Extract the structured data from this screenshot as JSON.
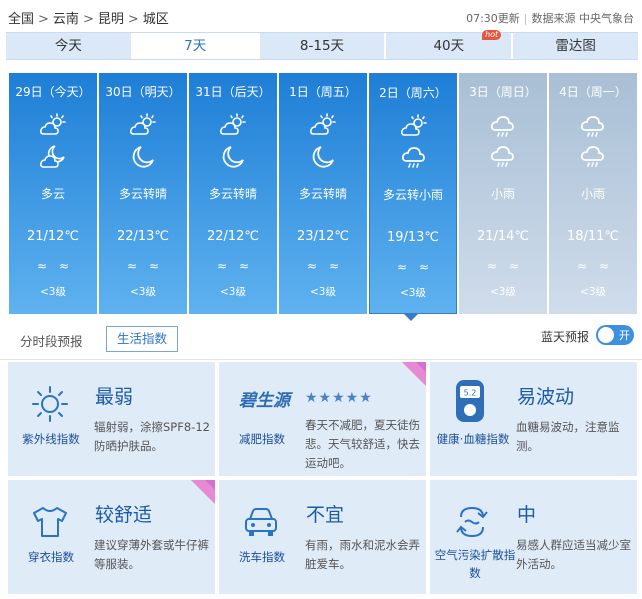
{
  "breadcrumb": [
    "全国",
    "云南",
    "昆明",
    "城区"
  ],
  "breadcrumb_sep": ">",
  "update_time": "07:30更新",
  "source": "数据来源 中央气象台",
  "tabs": [
    {
      "label": "今天",
      "active": false
    },
    {
      "label": "7天",
      "active": true
    },
    {
      "label": "8-15天",
      "active": false
    },
    {
      "label": "40天",
      "active": false,
      "badge": "hot"
    },
    {
      "label": "雷达图",
      "active": false
    }
  ],
  "days": [
    {
      "date": "29日（今天）",
      "icon1": "partly-cloudy-day-icon",
      "icon2": "partly-cloudy-night-icon",
      "desc": "多云",
      "temp": "21/12℃",
      "wave": "≈≈",
      "wind": "<3级",
      "style": "sun"
    },
    {
      "date": "30日（明天）",
      "icon1": "partly-cloudy-day-icon",
      "icon2": "moon-icon",
      "desc": "多云转晴",
      "temp": "22/13℃",
      "wave": "≈≈",
      "wind": "<3级",
      "style": "sun"
    },
    {
      "date": "31日（后天）",
      "icon1": "partly-cloudy-day-icon",
      "icon2": "moon-icon",
      "desc": "多云转晴",
      "temp": "22/12℃",
      "wave": "≈≈",
      "wind": "<3级",
      "style": "sun"
    },
    {
      "date": "1日（周五）",
      "icon1": "partly-cloudy-day-icon",
      "icon2": "moon-icon",
      "desc": "多云转晴",
      "temp": "23/12℃",
      "wave": "≈≈",
      "wind": "<3级",
      "style": "sun"
    },
    {
      "date": "2日（周六）",
      "icon1": "partly-cloudy-day-icon",
      "icon2": "light-rain-icon",
      "desc": "多云转小雨",
      "temp": "19/13℃",
      "wave": "≈≈",
      "wind": "<3级",
      "style": "sun",
      "selected": true
    },
    {
      "date": "3日（周日）",
      "icon1": "light-rain-icon",
      "icon2": "light-rain-icon",
      "desc": "小雨",
      "temp": "21/14℃",
      "wave": "≈≈",
      "wind": "<3级",
      "style": "rain"
    },
    {
      "date": "4日（周一）",
      "icon1": "light-rain-icon",
      "icon2": "light-rain-icon",
      "desc": "小雨",
      "temp": "18/11℃",
      "wave": "≈≈",
      "wind": "<3级",
      "style": "rain"
    }
  ],
  "subbar": {
    "hourly": "分时段预报",
    "life_index": "生活指数",
    "bluesky": "蓝天预报",
    "toggle_text": "开"
  },
  "cards": [
    {
      "caption": "紫外线指数",
      "level": "最弱",
      "text": "辐射弱，涂擦SPF8-12防晒护肤品。",
      "icon": "sun-icon"
    },
    {
      "caption": "减肥指数",
      "level": "",
      "text": "春天不减肥，夏天徒伤悲。天气较舒适，快去运动吧。",
      "icon": "logo-icon",
      "logo": "碧生源",
      "stars": "★★★★★",
      "corner": true
    },
    {
      "caption": "健康·血糖指数",
      "level": "易波动",
      "text": "血糖易波动，注意监测。",
      "icon": "glucose-meter-icon",
      "meter": "5.2"
    },
    {
      "caption": "穿衣指数",
      "level": "较舒适",
      "text": "建议穿薄外套或牛仔裤等服装。",
      "icon": "tshirt-icon",
      "corner": true
    },
    {
      "caption": "洗车指数",
      "level": "不宜",
      "text": "有雨，雨水和泥水会弄脏爱车。",
      "icon": "car-icon"
    },
    {
      "caption": "空气污染扩散指数",
      "level": "中",
      "text": "易感人群应适当减少室外活动。",
      "icon": "air-diffusion-icon"
    }
  ],
  "colors": {
    "sunny_top": "#1e7ed6",
    "rain_top": "#a9bfd5",
    "card_bg": "#e0ebf8",
    "accent": "#2a74c6"
  }
}
